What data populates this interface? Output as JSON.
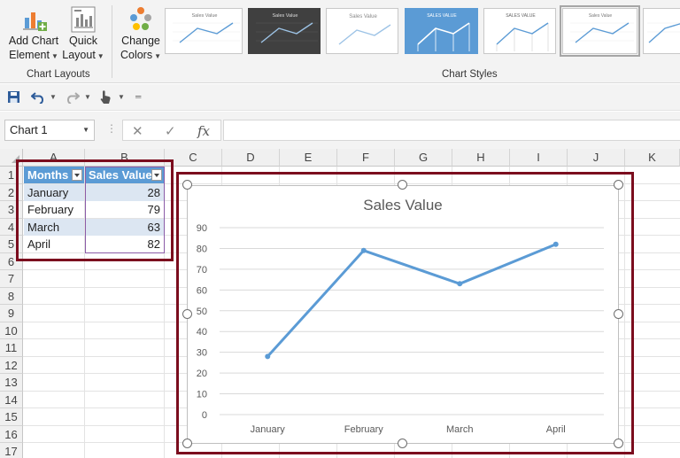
{
  "ribbon": {
    "add_chart_element": {
      "line1": "Add Chart",
      "line2": "Element"
    },
    "quick_layout": {
      "line1": "Quick",
      "line2": "Layout"
    },
    "change_colors": {
      "line1": "Change",
      "line2": "Colors"
    },
    "group_chart_layouts": "Chart Layouts",
    "group_chart_styles": "Chart Styles",
    "style_thumb_titles": [
      "Sales Value",
      "Sales Value",
      "Sales Value",
      "SALES VALUE",
      "SALES VALUE",
      "Sales Value",
      ""
    ]
  },
  "formula_bar": {
    "name_box": "Chart 1",
    "cancel_glyph": "✕",
    "enter_glyph": "✓",
    "fx_label": "fx",
    "formula": ""
  },
  "sheet": {
    "columns": [
      "A",
      "B",
      "C",
      "D",
      "E",
      "F",
      "G",
      "H",
      "I",
      "J",
      "K"
    ],
    "rows": [
      "1",
      "2",
      "3",
      "4",
      "5",
      "6",
      "7",
      "8",
      "9",
      "10",
      "11",
      "12",
      "13",
      "14",
      "15",
      "16",
      "17"
    ],
    "table": {
      "headers": [
        "Months",
        "Sales Value"
      ],
      "rows": [
        {
          "month": "January",
          "value": "28"
        },
        {
          "month": "February",
          "value": "79"
        },
        {
          "month": "March",
          "value": "63"
        },
        {
          "month": "April",
          "value": "82"
        }
      ]
    }
  },
  "chart_data": {
    "type": "line",
    "title": "Sales Value",
    "categories": [
      "January",
      "February",
      "March",
      "April"
    ],
    "series": [
      {
        "values": [
          28,
          79,
          63,
          82
        ],
        "color": "#5b9bd5"
      }
    ],
    "ylim": [
      0,
      90
    ],
    "yticks": [
      0,
      10,
      20,
      30,
      40,
      50,
      60,
      70,
      80,
      90
    ],
    "xlabel": "",
    "ylabel": "",
    "grid": true,
    "legend": "none"
  },
  "colors": {
    "accent": "#5b9bd5",
    "highlight_border": "#7b0d1e",
    "table_band": "#dce6f2"
  }
}
